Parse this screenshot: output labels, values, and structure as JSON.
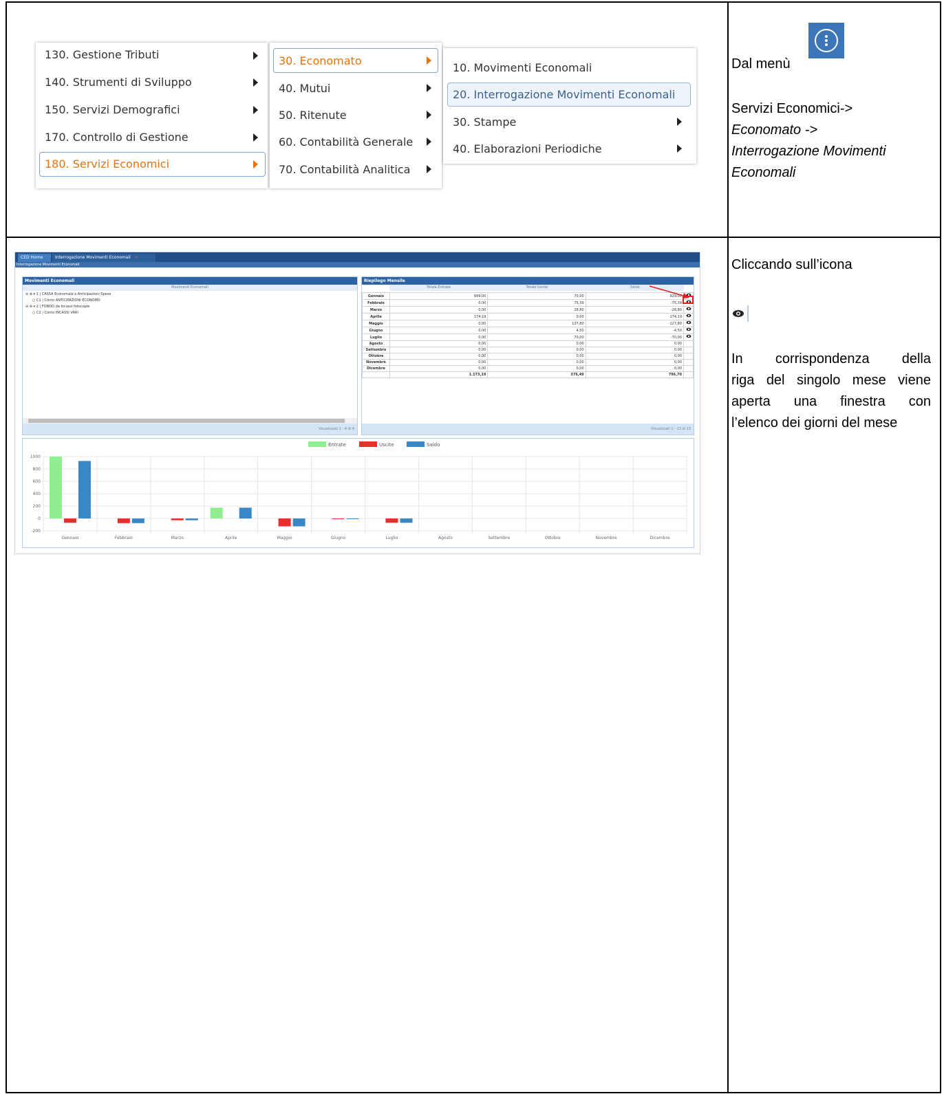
{
  "menu": {
    "col1": [
      {
        "label": "130. Gestione Tributi",
        "highlighted": false
      },
      {
        "label": "140. Strumenti di Sviluppo",
        "highlighted": false
      },
      {
        "label": "150. Servizi Demografici",
        "highlighted": false
      },
      {
        "label": "170. Controllo di Gestione",
        "highlighted": false
      },
      {
        "label": "180. Servizi Economici",
        "highlighted": true
      }
    ],
    "col2": [
      {
        "label": "30. Economato",
        "highlighted": true
      },
      {
        "label": "40. Mutui",
        "highlighted": false
      },
      {
        "label": "50. Ritenute",
        "highlighted": false
      },
      {
        "label": "60. Contabilità Generale",
        "highlighted": false
      },
      {
        "label": "70. Contabilità Analitica",
        "highlighted": false
      }
    ],
    "col3": [
      {
        "label": "10. Movimenti Economali",
        "selected": false,
        "submenu": false
      },
      {
        "label": "20. Interrogazione Movimenti Economali",
        "selected": true,
        "submenu": false
      },
      {
        "label": "30. Stampe",
        "selected": false,
        "submenu": true
      },
      {
        "label": "40. Elaborazioni Periodiche",
        "selected": false,
        "submenu": true
      }
    ],
    "highlight_color": "#e8730c"
  },
  "instructions": {
    "step1_prefix": "Dal menù",
    "step1_path_first": "Servizi Economici->",
    "step1_path_second": "Economato ->",
    "step1_path_third": "Interrogazione Movimenti",
    "step1_path_fourth": "Economali",
    "step2_line1": "Cliccando sull’icona",
    "step2_icon": "eye-icon",
    "step2_desc_1": "In corrispondenza della",
    "step2_desc_2": "riga del singolo mese viene",
    "step2_desc_3": "aperta una finestra con",
    "step2_desc_4": "l’elenco dei giorni del mese",
    "menu_button_color": "#3d76b8"
  },
  "app": {
    "tabs": [
      "CED Home",
      "Interrogazione Movimenti Economali"
    ],
    "breadcrumb": "Interrogazione Movimenti Economali",
    "left_panel": {
      "title": "Movimenti Economali",
      "column_header": "Movimenti Economali",
      "rows": [
        "⊖ ⊕ ▾ 1 | CASSA Economale x Anticipazioni Spese",
        "○ C1 | Conto ANTICIPAZIONI ECONOMO",
        "⊖ ⊕ ▾ 2 | FONDO da Incassi fotocopie",
        "○ C2 | Conto INCASSI VARI"
      ],
      "footer": "Visualizzati 1 - 4 di 4"
    },
    "right_panel": {
      "title": "Riepilogo Mensile",
      "headers": [
        "Totale Entrate",
        "Totale Uscite",
        "Saldo"
      ],
      "rows": [
        {
          "mese": "Gennaio",
          "entrate": "999,00",
          "uscite": "70,00",
          "saldo": "929,00",
          "eye": true
        },
        {
          "mese": "Febbraio",
          "entrate": "0,00",
          "uscite": "75,39",
          "saldo": "-75,39",
          "eye": true
        },
        {
          "mese": "Marzo",
          "entrate": "0,00",
          "uscite": "28,80",
          "saldo": "-28,80",
          "eye": true
        },
        {
          "mese": "Aprile",
          "entrate": "174,19",
          "uscite": "0,00",
          "saldo": "174,19",
          "eye": true
        },
        {
          "mese": "Maggio",
          "entrate": "0,00",
          "uscite": "127,80",
          "saldo": "-127,80",
          "eye": true
        },
        {
          "mese": "Giugno",
          "entrate": "0,00",
          "uscite": "4,50",
          "saldo": "-4,50",
          "eye": true
        },
        {
          "mese": "Luglio",
          "entrate": "0,00",
          "uscite": "70,00",
          "saldo": "-70,00",
          "eye": true
        },
        {
          "mese": "Agosto",
          "entrate": "0,00",
          "uscite": "0,00",
          "saldo": "0,00",
          "eye": false
        },
        {
          "mese": "Settembre",
          "entrate": "0,00",
          "uscite": "0,00",
          "saldo": "0,00",
          "eye": false
        },
        {
          "mese": "Ottobre",
          "entrate": "0,00",
          "uscite": "0,00",
          "saldo": "0,00",
          "eye": false
        },
        {
          "mese": "Novembre",
          "entrate": "0,00",
          "uscite": "0,00",
          "saldo": "0,00",
          "eye": false
        },
        {
          "mese": "Dicembre",
          "entrate": "0,00",
          "uscite": "0,00",
          "saldo": "0,00",
          "eye": false
        }
      ],
      "totals": {
        "entrate": "1.173,19",
        "uscite": "376,49",
        "saldo": "796,70"
      },
      "footer": "Visualizzati 1 - 13 di 13"
    }
  },
  "chart_data": {
    "type": "bar",
    "categories": [
      "Gennaio",
      "Febbraio",
      "Marzo",
      "Aprile",
      "Maggio",
      "Giugno",
      "Luglio",
      "Agosto",
      "Settembre",
      "Ottobre",
      "Novembre",
      "Dicembre"
    ],
    "series": [
      {
        "name": "Entrate",
        "color": "#90ee90",
        "values": [
          999,
          0,
          0,
          174.19,
          0,
          0,
          0,
          0,
          0,
          0,
          0,
          0
        ]
      },
      {
        "name": "Uscite",
        "color": "#ee2c2c",
        "values": [
          -70,
          -75.39,
          -28.8,
          0,
          -127.8,
          -4.5,
          -70,
          0,
          0,
          0,
          0,
          0
        ]
      },
      {
        "name": "Saldo",
        "color": "#3a87c8",
        "values": [
          929,
          -75.39,
          -28.8,
          174.19,
          -127.8,
          -4.5,
          -70,
          0,
          0,
          0,
          0,
          0
        ]
      }
    ],
    "yticks": [
      1000,
      800,
      600,
      400,
      200,
      0,
      -200
    ],
    "ylim": [
      -200,
      1000
    ],
    "grid": true,
    "legend": "top-center"
  }
}
